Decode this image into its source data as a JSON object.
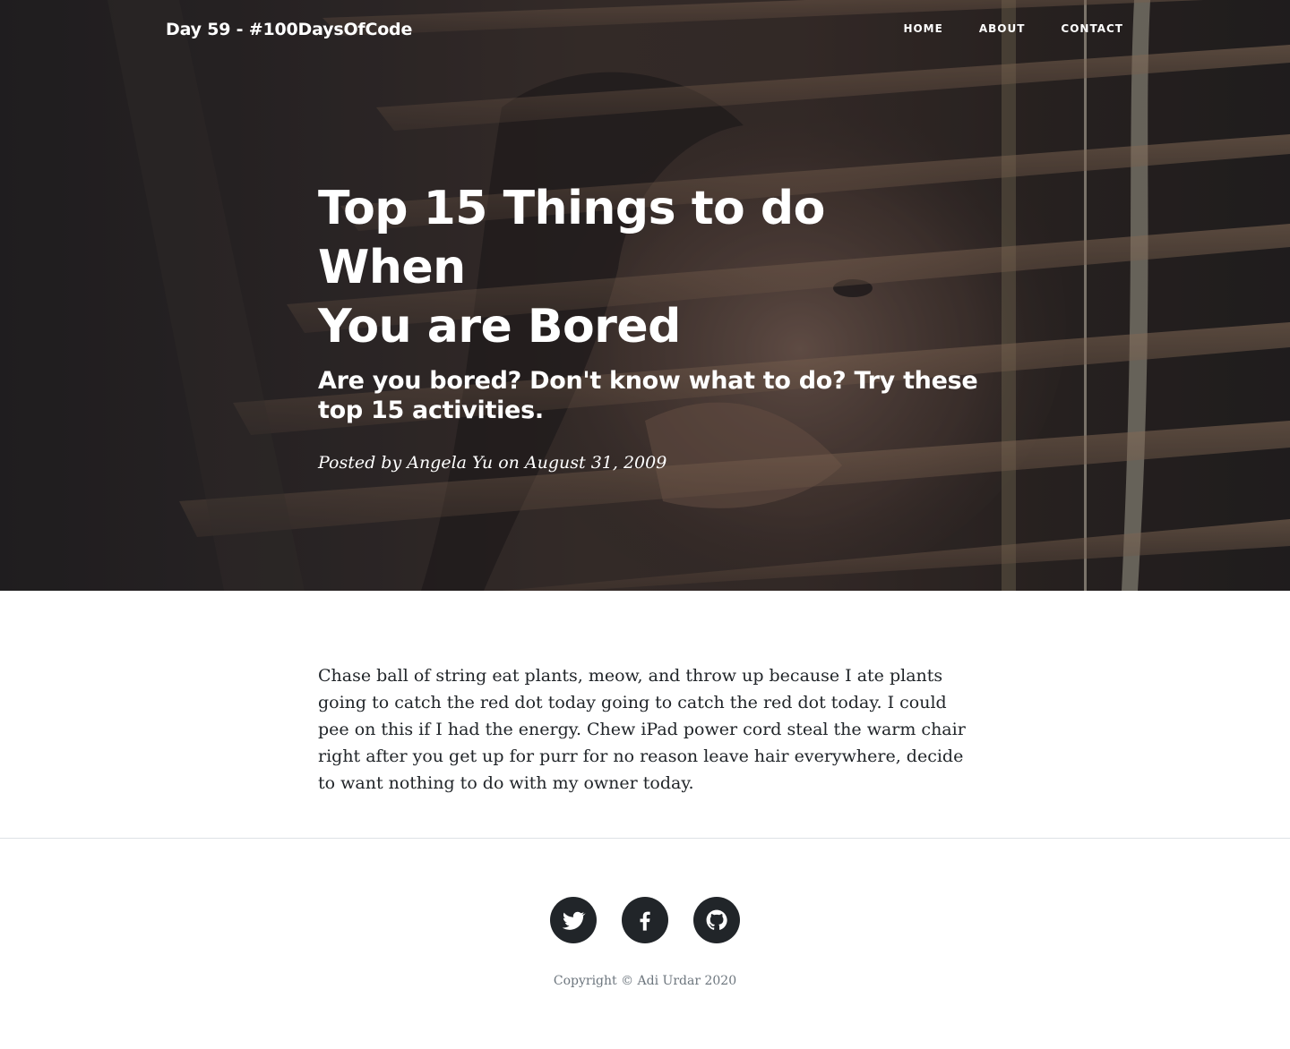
{
  "navbar": {
    "brand": "Day 59 - #100DaysOfCode",
    "links": [
      "HOME",
      "ABOUT",
      "CONTACT"
    ]
  },
  "header": {
    "title_line1": "Top 15 Things to do When",
    "title_line2": "You are Bored",
    "subtitle": "Are you bored? Don't know what to do? Try these top 15 activities.",
    "meta": "Posted by Angela Yu on August 31, 2009"
  },
  "article": {
    "body": "Chase ball of string eat plants, meow, and throw up because I ate plants going to catch the red dot today going to catch the red dot today. I could pee on this if I had the energy. Chew iPad power cord steal the warm chair right after you get up for purr for no reason leave hair everywhere, decide to want nothing to do with my owner today."
  },
  "footer": {
    "social_icons": [
      "twitter-icon",
      "facebook-icon",
      "github-icon"
    ],
    "copyright": "Copyright © Adi Urdar 2020"
  },
  "colors": {
    "icon_circle": "#212529",
    "text": "#212529",
    "muted": "#6c757d",
    "divider": "#dee2e6"
  }
}
